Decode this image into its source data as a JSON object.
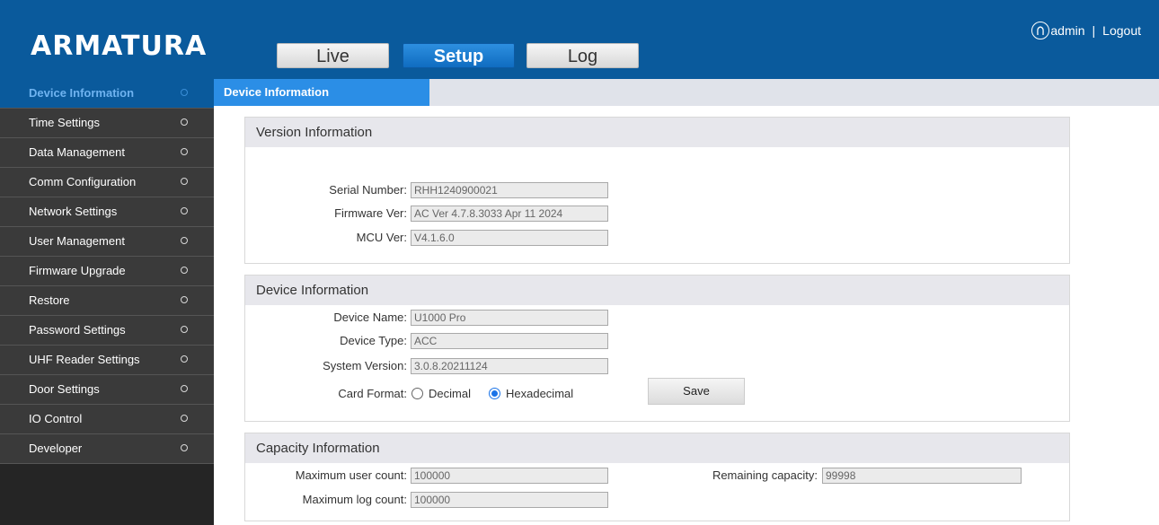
{
  "header": {
    "logo": "ARMATURA",
    "tabs": [
      {
        "label": "Live"
      },
      {
        "label": "Setup"
      },
      {
        "label": "Log"
      }
    ],
    "user": "admin",
    "separator": "|",
    "logout": "Logout"
  },
  "sidebar": {
    "items": [
      {
        "label": "Device Information"
      },
      {
        "label": "Time Settings"
      },
      {
        "label": "Data Management"
      },
      {
        "label": "Comm Configuration"
      },
      {
        "label": "Network Settings"
      },
      {
        "label": "User Management"
      },
      {
        "label": "Firmware Upgrade"
      },
      {
        "label": "Restore"
      },
      {
        "label": "Password Settings"
      },
      {
        "label": "UHF Reader Settings"
      },
      {
        "label": "Door Settings"
      },
      {
        "label": "IO Control"
      },
      {
        "label": "Developer"
      }
    ]
  },
  "subheader": {
    "tab": "Device Information"
  },
  "version": {
    "title": "Version Information",
    "serial_label": "Serial Number:",
    "serial_value": "RHH1240900021",
    "firmware_label": "Firmware Ver:",
    "firmware_value": "AC Ver 4.7.8.3033 Apr 11 2024",
    "mcu_label": "MCU Ver:",
    "mcu_value": "V4.1.6.0"
  },
  "device": {
    "title": "Device Information",
    "name_label": "Device Name:",
    "name_value": "U1000 Pro",
    "type_label": "Device Type:",
    "type_value": "ACC",
    "sysver_label": "System Version:",
    "sysver_value": "3.0.8.20211124",
    "card_label": "Card Format:",
    "option_decimal": "Decimal",
    "option_hex": "Hexadecimal",
    "selected": "Hexadecimal",
    "save": "Save"
  },
  "capacity": {
    "title": "Capacity Information",
    "max_user_label": "Maximum user count:",
    "max_user_value": "100000",
    "max_log_label": "Maximum log count:",
    "max_log_value": "100000",
    "remaining_label": "Remaining capacity:",
    "remaining_value": "99998"
  }
}
